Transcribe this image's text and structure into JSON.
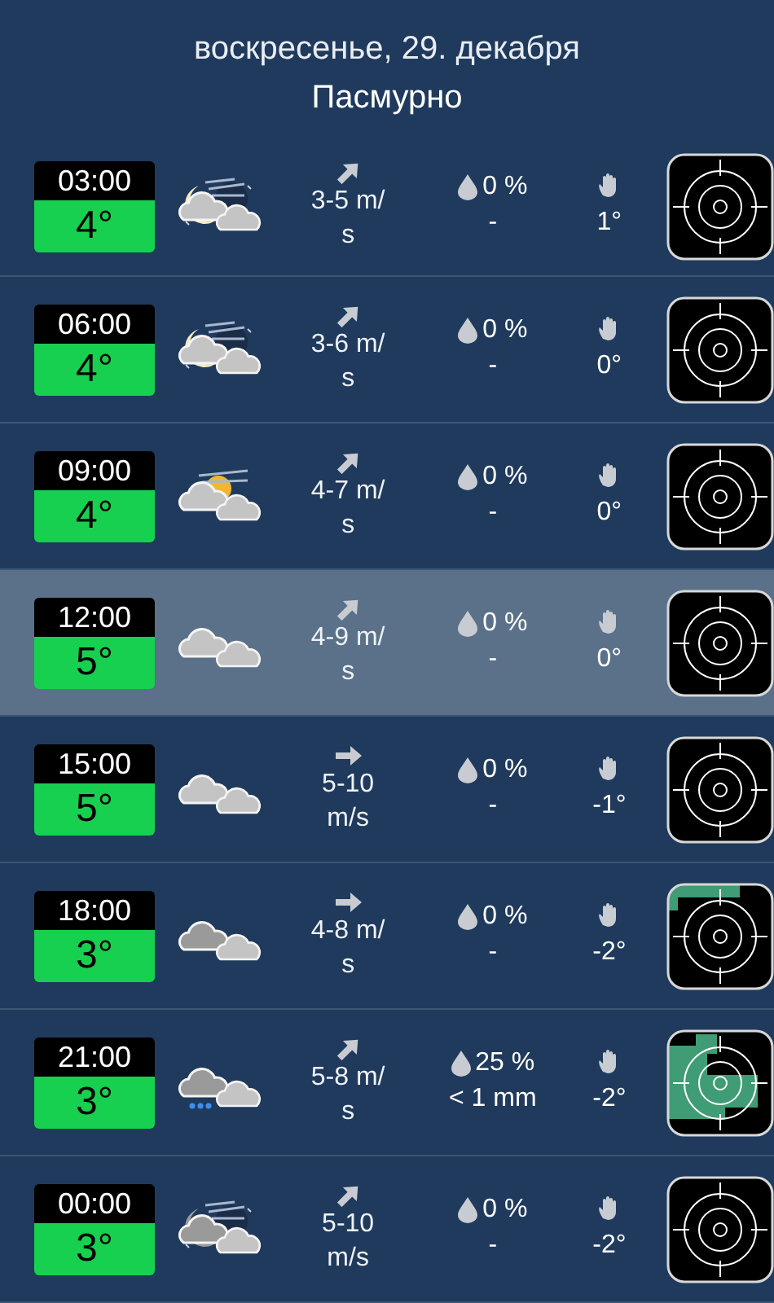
{
  "header": {
    "date": "воскресенье, 29. декабря",
    "condition": "Пасмурно"
  },
  "rows": [
    {
      "time": "03:00",
      "temp": "4°",
      "weather": {
        "kind": "nightwind"
      },
      "arrow": {
        "kind": "diagonal"
      },
      "wind": [
        "3-5 m/",
        "s"
      ],
      "rain_chance": "0 %",
      "rain_amount": "-",
      "feels": "1°",
      "radar": {
        "kind": "clear"
      },
      "selected": false
    },
    {
      "time": "06:00",
      "temp": "4°",
      "weather": {
        "kind": "nightwind"
      },
      "arrow": {
        "kind": "diagonal"
      },
      "wind": [
        "3-6 m/",
        "s"
      ],
      "rain_chance": "0 %",
      "rain_amount": "-",
      "feels": "0°",
      "radar": {
        "kind": "clear"
      },
      "selected": false
    },
    {
      "time": "09:00",
      "temp": "4°",
      "weather": {
        "kind": "daywind"
      },
      "arrow": {
        "kind": "diagonal"
      },
      "wind": [
        "4-7 m/",
        "s"
      ],
      "rain_chance": "0 %",
      "rain_amount": "-",
      "feels": "0°",
      "radar": {
        "kind": "clear"
      },
      "selected": false
    },
    {
      "time": "12:00",
      "temp": "5°",
      "weather": {
        "kind": "cloudy"
      },
      "arrow": {
        "kind": "diagonal"
      },
      "wind": [
        "4-9 m/",
        "s"
      ],
      "rain_chance": "0 %",
      "rain_amount": "-",
      "feels": "0°",
      "radar": {
        "kind": "clear"
      },
      "selected": true
    },
    {
      "time": "15:00",
      "temp": "5°",
      "weather": {
        "kind": "cloudy"
      },
      "arrow": {
        "kind": "horizontal"
      },
      "wind": [
        "5-10",
        "m/s"
      ],
      "rain_chance": "0 %",
      "rain_amount": "-",
      "feels": "-1°",
      "radar": {
        "kind": "clear"
      },
      "selected": false
    },
    {
      "time": "18:00",
      "temp": "3°",
      "weather": {
        "kind": "overcast"
      },
      "arrow": {
        "kind": "horizontal"
      },
      "wind": [
        "4-8 m/",
        "s"
      ],
      "rain_chance": "0 %",
      "rain_amount": "-",
      "feels": "-2°",
      "radar": {
        "kind": "edge"
      },
      "selected": false
    },
    {
      "time": "21:00",
      "temp": "3°",
      "weather": {
        "kind": "rain"
      },
      "arrow": {
        "kind": "diagonal"
      },
      "wind": [
        "5-8 m/",
        "s"
      ],
      "rain_chance": "25 %",
      "rain_amount": "< 1 mm",
      "feels": "-2°",
      "radar": {
        "kind": "mostly"
      },
      "selected": false
    },
    {
      "time": "00:00",
      "temp": "3°",
      "weather": {
        "kind": "darkwind"
      },
      "arrow": {
        "kind": "diagonal"
      },
      "wind": [
        "5-10",
        "m/s"
      ],
      "rain_chance": "0 %",
      "rain_amount": "-",
      "feels": "-2°",
      "radar": {
        "kind": "clear"
      },
      "selected": false
    }
  ]
}
